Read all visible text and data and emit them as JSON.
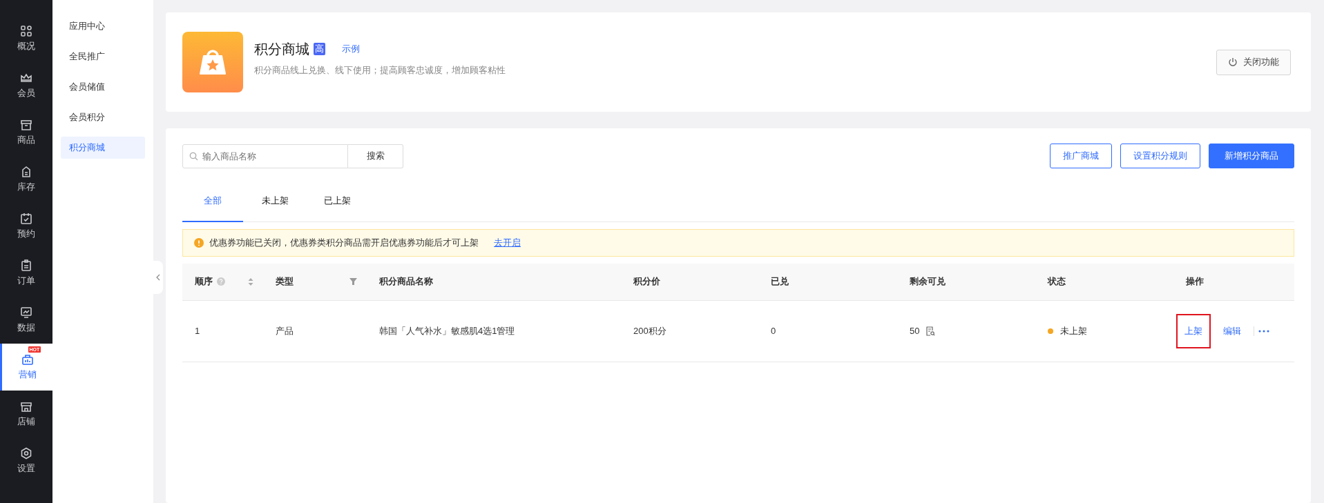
{
  "nav": {
    "items": [
      {
        "label": "概况",
        "selected": false
      },
      {
        "label": "会员",
        "selected": false
      },
      {
        "label": "商品",
        "selected": false
      },
      {
        "label": "库存",
        "selected": false
      },
      {
        "label": "预约",
        "selected": false
      },
      {
        "label": "订单",
        "selected": false
      },
      {
        "label": "数据",
        "selected": false
      },
      {
        "label": "营销",
        "selected": true,
        "badge": "HOT"
      },
      {
        "label": "店铺",
        "selected": false
      },
      {
        "label": "设置",
        "selected": false
      }
    ]
  },
  "submenu": {
    "items": [
      {
        "label": "应用中心",
        "selected": false
      },
      {
        "label": "全民推广",
        "selected": false
      },
      {
        "label": "会员储值",
        "selected": false
      },
      {
        "label": "会员积分",
        "selected": false
      },
      {
        "label": "积分商城",
        "selected": true
      }
    ]
  },
  "header": {
    "title": "积分商城",
    "badge": "高",
    "link": "示例",
    "description": "积分商品线上兑换、线下使用；提高顾客忠诚度，增加顾客粘性",
    "close_button": "关闭功能"
  },
  "toolbar": {
    "search": {
      "placeholder": "输入商品名称",
      "button": "搜索"
    },
    "buttons": [
      {
        "label": "推广商城",
        "kind": "outline"
      },
      {
        "label": "设置积分规则",
        "kind": "outline"
      },
      {
        "label": "新增积分商品",
        "kind": "primary"
      }
    ]
  },
  "tabs": [
    {
      "label": "全部",
      "selected": true
    },
    {
      "label": "未上架",
      "selected": false
    },
    {
      "label": "已上架",
      "selected": false
    }
  ],
  "notice": {
    "text": "优惠券功能已关闭，优惠券类积分商品需开启优惠券功能后才可上架",
    "link": "去开启"
  },
  "table": {
    "columns": [
      {
        "label": "顺序",
        "kind": "sort"
      },
      {
        "label": "类型",
        "kind": "filter"
      },
      {
        "label": "积分商品名称",
        "kind": "plain"
      },
      {
        "label": "积分价",
        "kind": "plain"
      },
      {
        "label": "已兑",
        "kind": "plain"
      },
      {
        "label": "剩余可兑",
        "kind": "plain"
      },
      {
        "label": "状态",
        "kind": "plain"
      },
      {
        "label": "操作",
        "kind": "plain"
      }
    ],
    "rows": [
      {
        "order": "1",
        "type": "产品",
        "name": "韩国「人气补水」敏感肌4选1管理",
        "price": "200积分",
        "redeemed": "0",
        "remaining": "50",
        "status": {
          "text": "未上架",
          "color": "#f5a623"
        },
        "actions": [
          {
            "label": "上架",
            "highlighted": true
          },
          {
            "label": "编辑",
            "highlighted": false
          }
        ]
      }
    ]
  }
}
